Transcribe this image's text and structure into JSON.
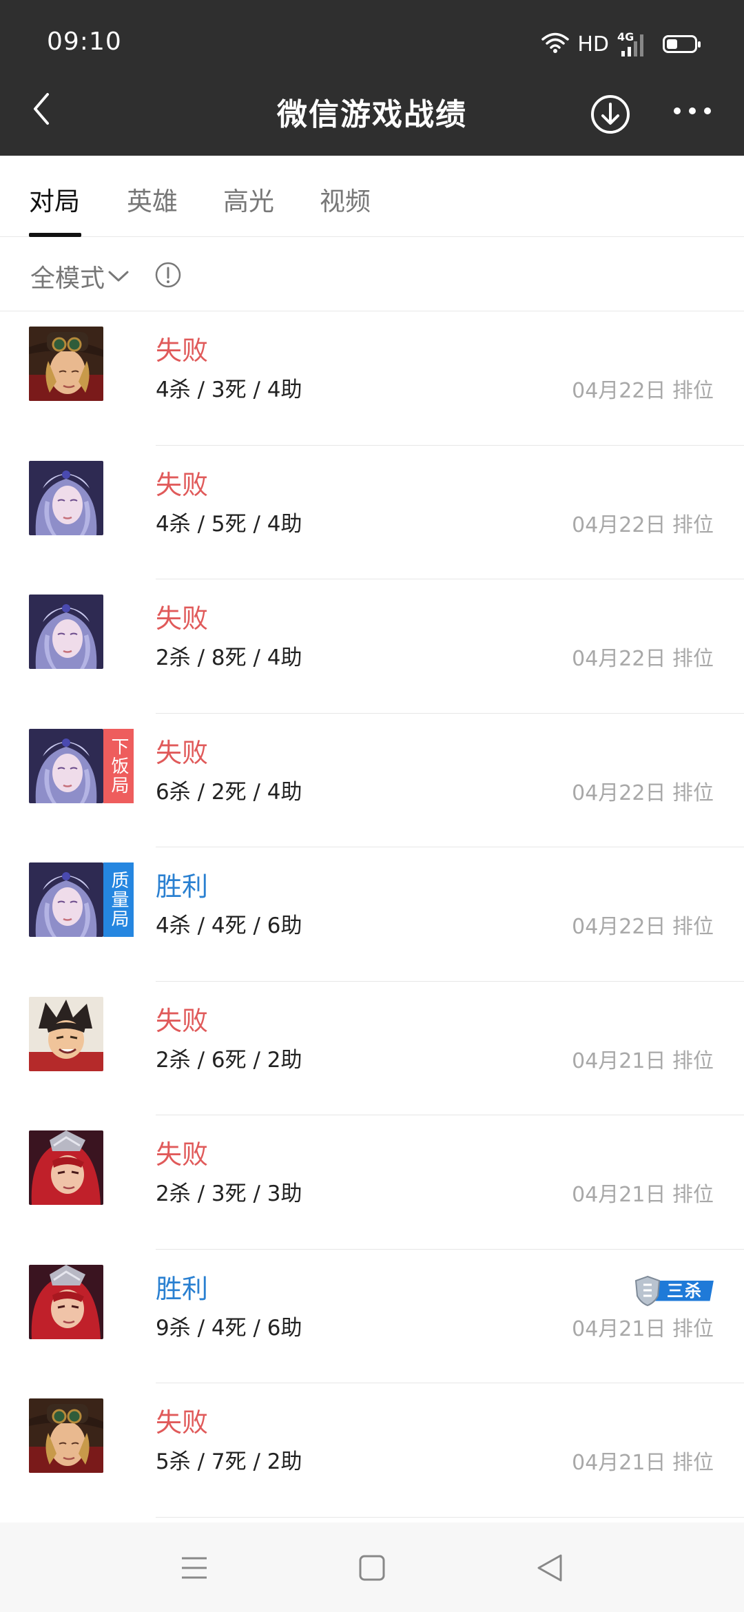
{
  "status": {
    "time": "09:10",
    "hd": "HD",
    "network": "4G",
    "battery_level": 0.4
  },
  "header": {
    "title": "微信游戏战绩",
    "back_icon": "chevron-left-icon",
    "download_icon": "download-icon",
    "more_icon": "more-icon"
  },
  "tabs": [
    {
      "label": "对局",
      "active": true
    },
    {
      "label": "英雄",
      "active": false
    },
    {
      "label": "高光",
      "active": false
    },
    {
      "label": "视频",
      "active": false
    }
  ],
  "filter": {
    "mode_label": "全模式",
    "info_icon": "info-icon"
  },
  "colors": {
    "loss": "#e05a5a",
    "win": "#2a80d1",
    "tag_bad": "#ee5d5d",
    "tag_good": "#2586e0",
    "topbar": "#2f2f2f"
  },
  "matches": [
    {
      "hero": "hero-cowboy",
      "result": "失败",
      "outcome": "loss",
      "kda": "4杀 / 3死 / 4助",
      "meta": "04月22日 排位",
      "tag": "",
      "badge": ""
    },
    {
      "hero": "hero-priestess",
      "result": "失败",
      "outcome": "loss",
      "kda": "4杀 / 5死 / 4助",
      "meta": "04月22日 排位",
      "tag": "",
      "badge": ""
    },
    {
      "hero": "hero-priestess",
      "result": "失败",
      "outcome": "loss",
      "kda": "2杀 / 8死 / 4助",
      "meta": "04月22日 排位",
      "tag": "",
      "badge": ""
    },
    {
      "hero": "hero-priestess",
      "result": "失败",
      "outcome": "loss",
      "kda": "6杀 / 2死 / 4助",
      "meta": "04月22日 排位",
      "tag": "下饭局",
      "tag_type": "bad",
      "badge": ""
    },
    {
      "hero": "hero-priestess",
      "result": "胜利",
      "outcome": "win",
      "kda": "4杀 / 4死 / 6助",
      "meta": "04月22日 排位",
      "tag": "质量局",
      "tag_type": "good",
      "badge": ""
    },
    {
      "hero": "hero-wildboy",
      "result": "失败",
      "outcome": "loss",
      "kda": "2杀 / 6死 / 2助",
      "meta": "04月21日 排位",
      "tag": "",
      "badge": ""
    },
    {
      "hero": "hero-redhair",
      "result": "失败",
      "outcome": "loss",
      "kda": "2杀 / 3死 / 3助",
      "meta": "04月21日 排位",
      "tag": "",
      "badge": ""
    },
    {
      "hero": "hero-redhair",
      "result": "胜利",
      "outcome": "win",
      "kda": "9杀 / 4死 / 6助",
      "meta": "04月21日 排位",
      "tag": "",
      "badge": "三杀"
    },
    {
      "hero": "hero-cowboy",
      "result": "失败",
      "outcome": "loss",
      "kda": "5杀 / 7死 / 2助",
      "meta": "04月21日 排位",
      "tag": "",
      "badge": ""
    }
  ],
  "bottom_nav": [
    {
      "icon": "menu-icon"
    },
    {
      "icon": "home-square-icon"
    },
    {
      "icon": "back-triangle-icon"
    }
  ]
}
